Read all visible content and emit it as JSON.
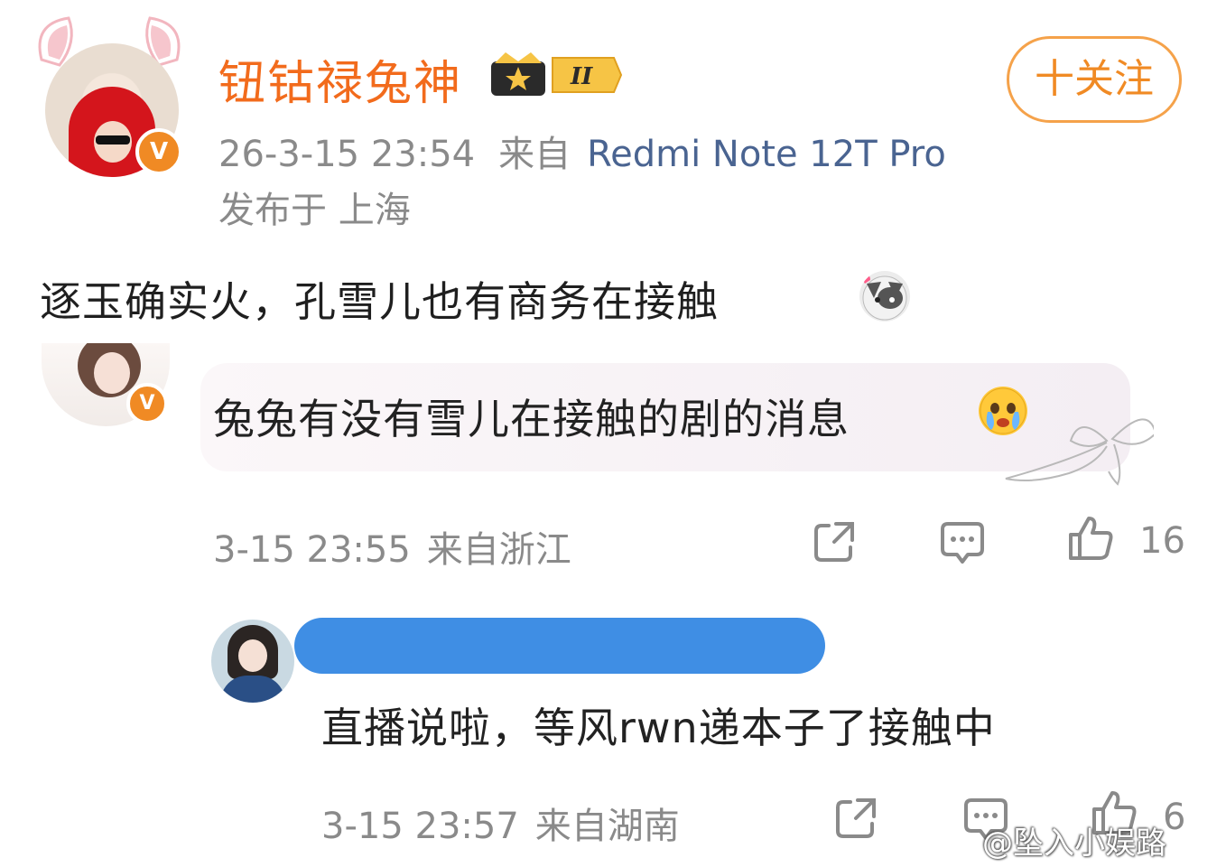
{
  "post": {
    "username": "钮钴禄兔神",
    "badge_level": "II",
    "verified_mark": "V",
    "timestamp": "26-3-15 23:54",
    "from_label": "来自",
    "device": "Redmi Note 12T Pro",
    "location": "发布于 上海",
    "follow_label": "十关注",
    "text": "逐玉确实火，孔雪儿也有商务在接触",
    "emoji_icon": "cat-emoji-icon"
  },
  "comment": {
    "verified_mark": "V",
    "text": "兔兔有没有雪儿在接触的剧的消息",
    "emoji_icon": "crying-face-icon",
    "timestamp": "3-15 23:55",
    "location": "来自浙江",
    "likes": "16"
  },
  "reply": {
    "text": "直播说啦，等风rwn递本子了接触中",
    "timestamp": "3-15 23:57",
    "location": "来自湖南",
    "likes": "6"
  },
  "watermark": "@坠入小娱路",
  "colors": {
    "username": "#f26b1c",
    "device": "#4a6491",
    "meta": "#8a8a8a",
    "follow_border": "#f5a24a",
    "verified": "#f08a24",
    "redaction": "#3f8ee4"
  }
}
